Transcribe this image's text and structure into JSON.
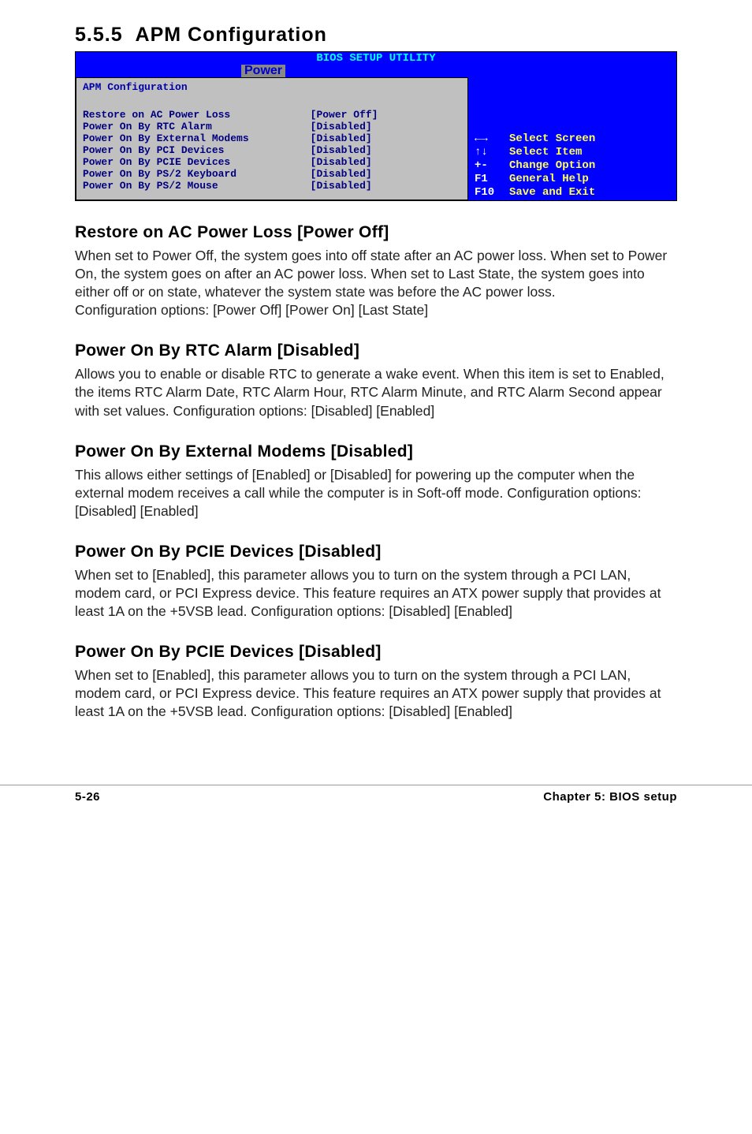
{
  "section_number": "5.5.5",
  "section_title": "APM Configuration",
  "bios": {
    "title": "BIOS SETUP UTILITY",
    "tab": "Power",
    "panel_title": "APM Configuration",
    "items": [
      {
        "label": "Restore on AC Power Loss",
        "value": "[Power Off]"
      },
      {
        "label": "Power On By RTC Alarm",
        "value": "[Disabled]"
      },
      {
        "label": "Power On By External Modems",
        "value": "[Disabled]"
      },
      {
        "label": "Power On By PCI Devices",
        "value": "[Disabled]"
      },
      {
        "label": "Power On By PCIE Devices",
        "value": "[Disabled]"
      },
      {
        "label": "Power On By PS/2 Keyboard",
        "value": "[Disabled]"
      },
      {
        "label": "Power On By PS/2 Mouse",
        "value": "[Disabled]"
      }
    ],
    "legend": [
      {
        "key": "←→",
        "val": "Select Screen"
      },
      {
        "key": "↑↓",
        "val": "Select Item"
      },
      {
        "key": "+-",
        "val": "Change Option"
      },
      {
        "key": "F1",
        "val": "General Help"
      },
      {
        "key": "F10",
        "val": "Save and Exit"
      }
    ]
  },
  "sections": [
    {
      "heading": "Restore on AC Power Loss [Power Off]",
      "body": "When set to Power Off, the system goes into off state after an AC power loss. When set to Power On, the system goes on after an AC power loss. When set to Last State, the system goes into either off or on state, whatever the system state was before the AC power loss.\nConfiguration options: [Power Off] [Power On] [Last State]"
    },
    {
      "heading": "Power On By RTC Alarm [Disabled]",
      "body": "Allows you to enable or disable RTC to generate a wake event. When this item is set to Enabled, the items RTC Alarm Date, RTC Alarm Hour, RTC Alarm Minute, and RTC Alarm Second appear with set values. Configuration options: [Disabled] [Enabled]"
    },
    {
      "heading": "Power On By External Modems [Disabled]",
      "body": "This allows either settings of [Enabled] or [Disabled] for powering up the computer when the external modem receives a call while the computer is in Soft-off mode. Configuration options: [Disabled] [Enabled]"
    },
    {
      "heading": "Power On By PCIE Devices [Disabled]",
      "body": "When set to [Enabled], this parameter allows you to turn on the system through a PCI LAN, modem card, or PCI Express device. This feature requires an ATX power supply that provides at least 1A on the +5VSB lead. Configuration options: [Disabled] [Enabled]"
    },
    {
      "heading": "Power On By PCIE Devices [Disabled]",
      "body": "When set to [Enabled], this parameter allows you to turn on the system through a PCI LAN, modem card, or PCI Express device. This feature requires an ATX power supply that provides at least 1A on the +5VSB lead. Configuration options: [Disabled] [Enabled]"
    }
  ],
  "footer": {
    "left": "5-26",
    "right": "Chapter 5: BIOS setup"
  }
}
